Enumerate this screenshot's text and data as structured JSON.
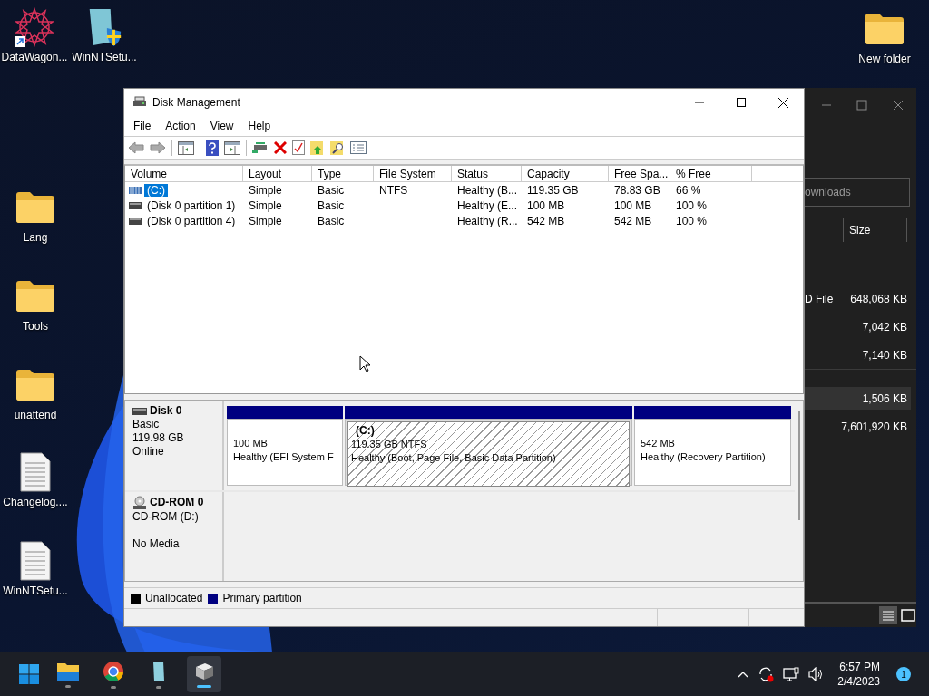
{
  "desktop_icons": [
    {
      "label": "DataWagon...",
      "kind": "star",
      "shortcut": true
    },
    {
      "label": "WinNTSetu...",
      "kind": "installer",
      "shortcut": false
    },
    {
      "label": "New folder",
      "kind": "folder",
      "shortcut": false
    },
    {
      "label": "Lang",
      "kind": "folder",
      "shortcut": false
    },
    {
      "label": "Tools",
      "kind": "folder",
      "shortcut": false
    },
    {
      "label": "unattend",
      "kind": "folder",
      "shortcut": false
    },
    {
      "label": "Changelog....",
      "kind": "document",
      "shortcut": false
    },
    {
      "label": "WinNTSetu...",
      "kind": "document",
      "shortcut": false
    }
  ],
  "background_window": {
    "search": {
      "placeholder": "ownloads"
    },
    "columns": [
      "Size"
    ],
    "rows": [
      {
        "column_1": "D File",
        "size": "648,068 KB",
        "selected": false
      },
      {
        "size": "7,042 KB",
        "selected": false
      },
      {
        "size": "7,140 KB",
        "selected": false
      },
      {
        "size": "1,506 KB",
        "selected": true
      },
      {
        "size": "7,601,920 KB",
        "selected": false
      }
    ]
  },
  "window": {
    "title": "Disk Management"
  },
  "menu": [
    "File",
    "Action",
    "View",
    "Help"
  ],
  "volume_table": {
    "columns": [
      "Volume",
      "Layout",
      "Type",
      "File System",
      "Status",
      "Capacity",
      "Free Spa...",
      "% Free"
    ],
    "rows": [
      {
        "cells": [
          "(C:)",
          "Simple",
          "Basic",
          "NTFS",
          "Healthy (B...",
          "119.35 GB",
          "78.83 GB",
          "66 %"
        ],
        "selected": true
      },
      {
        "cells": [
          "(Disk 0 partition 1)",
          "Simple",
          "Basic",
          "",
          "Healthy (E...",
          "100 MB",
          "100 MB",
          "100 %"
        ],
        "selected": false
      },
      {
        "cells": [
          "(Disk 0 partition 4)",
          "Simple",
          "Basic",
          "",
          "Healthy (R...",
          "542 MB",
          "542 MB",
          "100 %"
        ],
        "selected": false
      }
    ]
  },
  "disks": [
    {
      "kind": "disk",
      "name": "Disk 0",
      "type": "Basic",
      "size": "119.98 GB",
      "status": "Online",
      "partitions": [
        {
          "size": "100 MB",
          "status": "Healthy (EFI System F",
          "selected": false
        },
        {
          "label": "(C:)",
          "size": "119.35 GB NTFS",
          "status": "Healthy (Boot, Page File, Basic Data Partition)",
          "selected": true
        },
        {
          "size": "542 MB",
          "status": "Healthy (Recovery Partition)",
          "selected": false
        }
      ]
    },
    {
      "kind": "cdrom",
      "name": "CD-ROM 0",
      "type": "CD-ROM (D:)",
      "status": "No Media"
    }
  ],
  "legend": [
    {
      "label": "Unallocated",
      "color": "#000000"
    },
    {
      "label": "Primary partition",
      "color": "#000080"
    }
  ],
  "taskbar": {
    "apps": [
      {
        "kind": "explorer",
        "selected": false
      },
      {
        "kind": "browser",
        "selected": false
      },
      {
        "kind": "installer",
        "selected": false
      },
      {
        "kind": "disk",
        "selected": true
      }
    ],
    "time": "6:57 PM",
    "date": "2/4/2023",
    "notification_count": "1"
  }
}
